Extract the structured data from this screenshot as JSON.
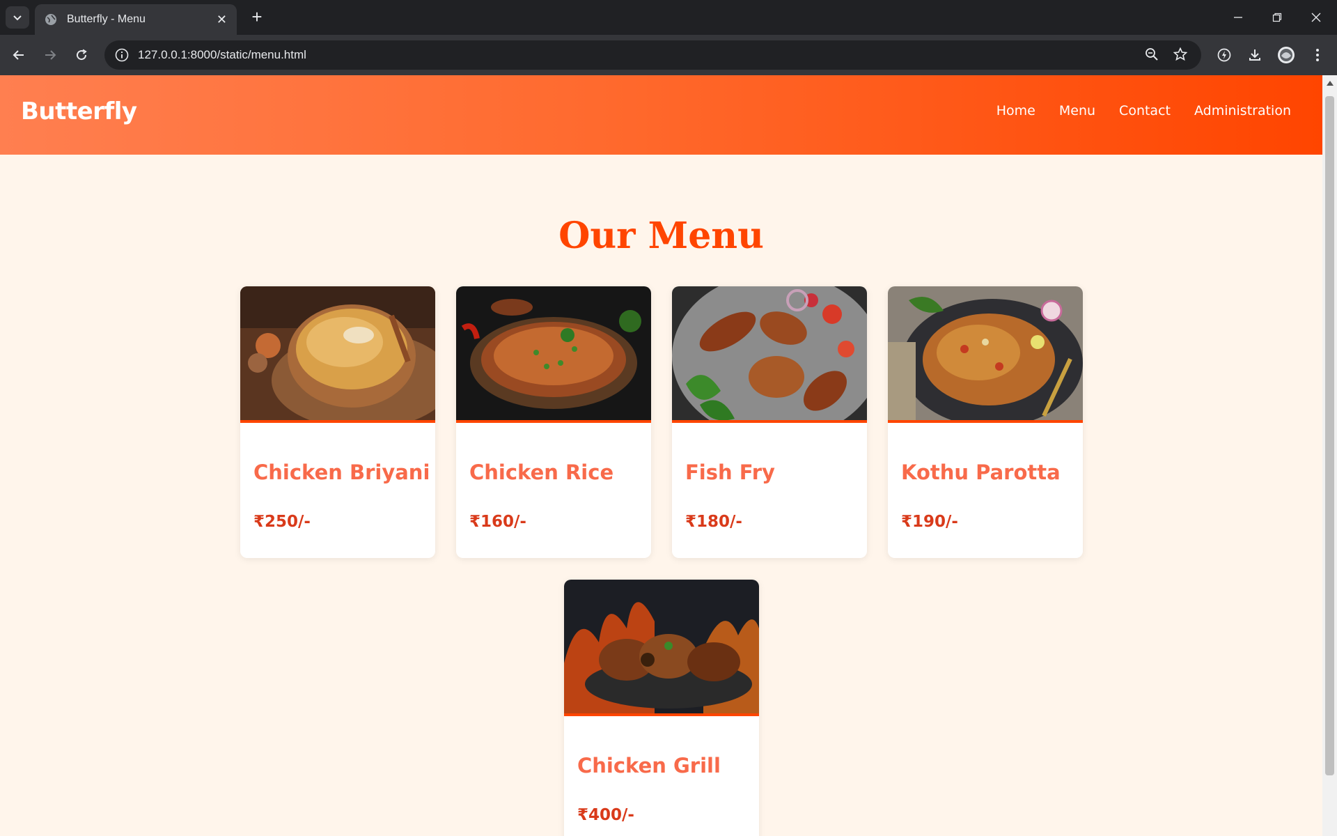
{
  "browser": {
    "tab_title": "Butterfly - Menu",
    "url": "127.0.0.1:8000/static/menu.html"
  },
  "site": {
    "brand": "Butterfly",
    "nav": [
      "Home",
      "Menu",
      "Contact",
      "Administration"
    ]
  },
  "main": {
    "title": "Our Menu",
    "items": [
      {
        "name": "Chicken Briyani",
        "price": "₹250/-",
        "image": "chicken-briyani-photo"
      },
      {
        "name": "Chicken Rice",
        "price": "₹160/-",
        "image": "chicken-rice-photo"
      },
      {
        "name": "Fish Fry",
        "price": "₹180/-",
        "image": "fish-fry-photo"
      },
      {
        "name": "Kothu Parotta",
        "price": "₹190/-",
        "image": "kothu-parotta-photo"
      },
      {
        "name": "Chicken Grill",
        "price": "₹400/-",
        "image": "chicken-grill-photo"
      }
    ]
  },
  "colors": {
    "header_start": "#ff7f50",
    "header_end": "#ff4500",
    "accent": "#ff4500",
    "page_bg": "#fff5eb"
  }
}
